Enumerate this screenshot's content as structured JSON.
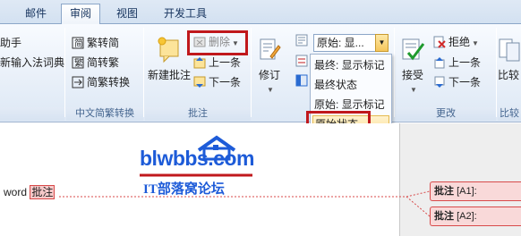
{
  "tabs": [
    {
      "label": "邮件",
      "active": false
    },
    {
      "label": "审阅",
      "active": true
    },
    {
      "label": "视图",
      "active": false
    },
    {
      "label": "开发工具",
      "active": false
    }
  ],
  "proofing": {
    "item1": "助手",
    "item2": "新输入法词典"
  },
  "chinese_conversion": {
    "trad_to_simp": "繁转简",
    "simp_to_trad": "简转繁",
    "convert": "简繁转换",
    "group_label": "中文简繁转换"
  },
  "comments": {
    "new_comment": "新建批注",
    "delete": "删除",
    "previous": "上一条",
    "next": "下一条",
    "group_label": "批注"
  },
  "tracking": {
    "track_changes": "修订",
    "display_select": "原始: 显...",
    "options": [
      "最终: 显示标记",
      "最终状态",
      "原始: 显示标记",
      "原始状态"
    ],
    "selected_option": "原始状态"
  },
  "changes": {
    "accept": "接受",
    "reject": "拒绝",
    "previous": "上一条",
    "next": "下一条",
    "group_label": "更改"
  },
  "compare": {
    "label": "比较",
    "group_label": "比较"
  },
  "watermark": {
    "site": "blwbbs.com",
    "subtitle": "IT部落窝论坛"
  },
  "document": {
    "text_prefix": "word ",
    "commented_text": "批注",
    "comments": [
      {
        "label": "批注",
        "ref": "[A1]:"
      },
      {
        "label": "批注",
        "ref": "[A2]:"
      }
    ]
  },
  "colors": {
    "highlight": "#c0181c",
    "accent": "#2b579a"
  }
}
